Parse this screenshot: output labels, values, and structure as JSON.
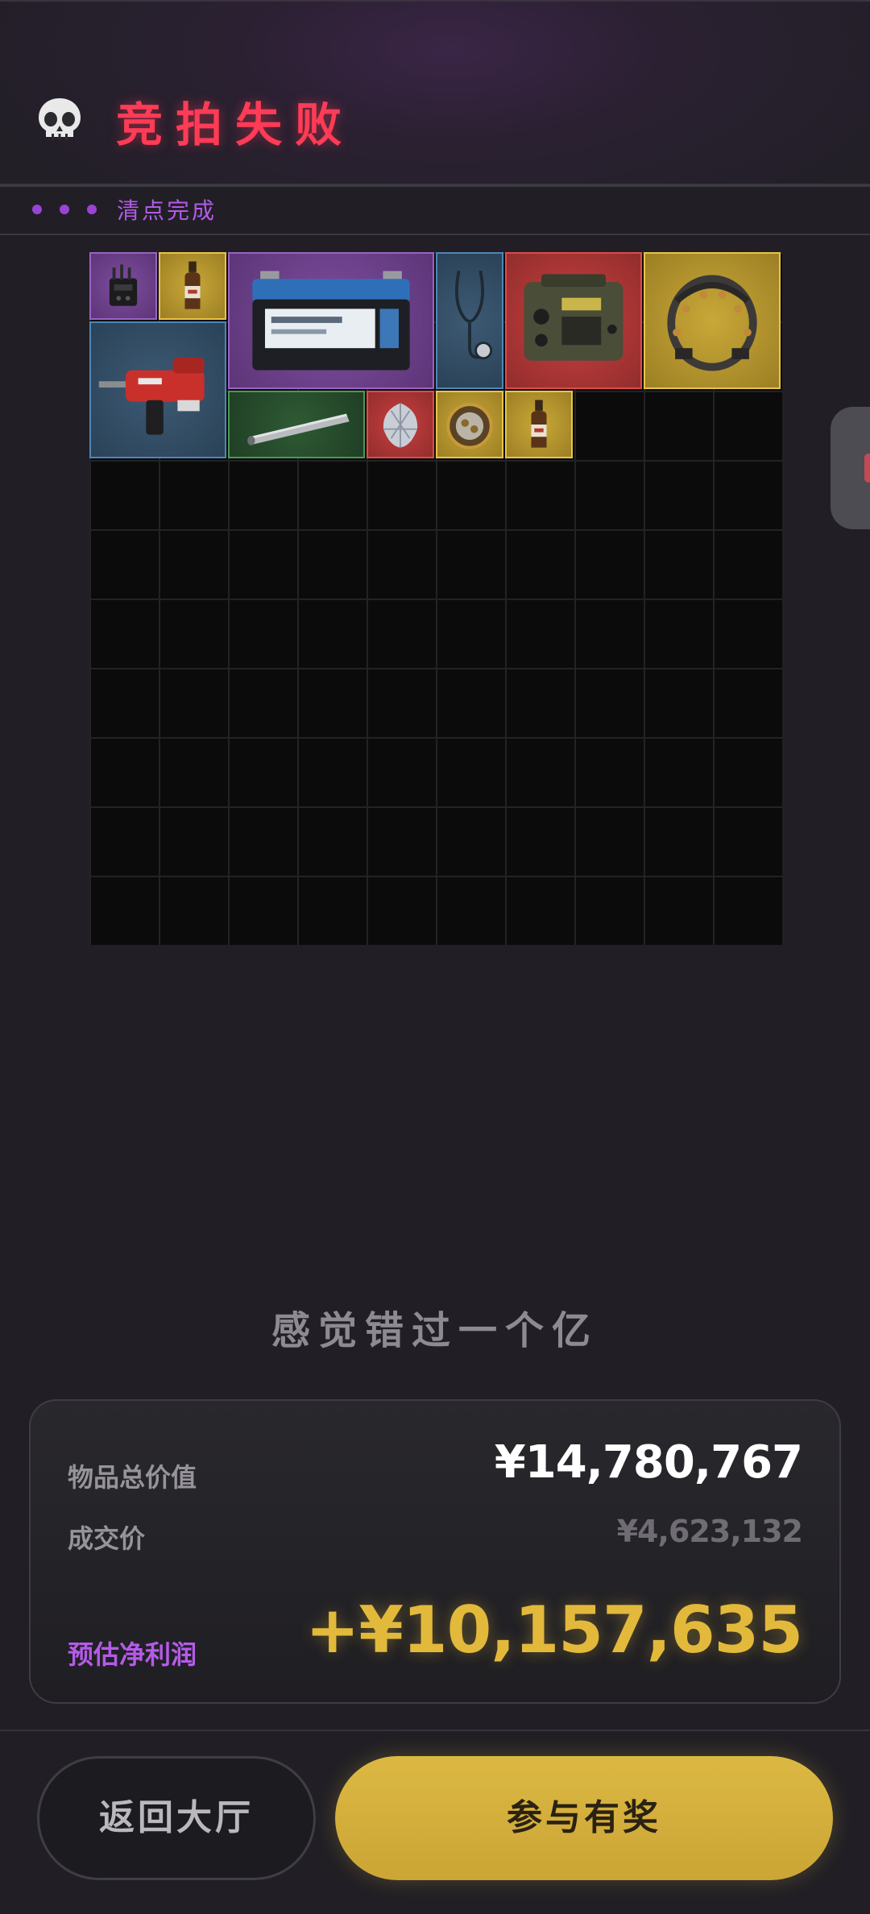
{
  "header": {
    "title": "竞拍失败",
    "skull_icon": "skull-icon"
  },
  "status": {
    "text": "清点完成",
    "dot_color": "#9a44d6"
  },
  "items": [
    {
      "name": "radio-transmitter",
      "rarity": "purple"
    },
    {
      "name": "liquor-bottle",
      "rarity": "gold"
    },
    {
      "name": "car-battery",
      "rarity": "purple"
    },
    {
      "name": "stethoscope",
      "rarity": "blue"
    },
    {
      "name": "military-radio",
      "rarity": "red"
    },
    {
      "name": "brain-helmet",
      "rarity": "gold"
    },
    {
      "name": "rotary-hammer-drill",
      "rarity": "blue"
    },
    {
      "name": "metal-rod",
      "rarity": "green"
    },
    {
      "name": "diamond",
      "rarity": "red"
    },
    {
      "name": "pocket-watch",
      "rarity": "gold"
    },
    {
      "name": "liquor-bottle",
      "rarity": "gold"
    }
  ],
  "tagline": "感觉错过一个亿",
  "summary": {
    "total_label": "物品总价值",
    "total_value": "¥14,780,767",
    "deal_label": "成交价",
    "deal_value": "¥4,623,132",
    "profit_label": "预估净利润",
    "profit_value": "+¥10,157,635"
  },
  "buttons": {
    "back": "返回大厅",
    "join": "参与有奖"
  },
  "colors": {
    "title": "#ff3b56",
    "profit": "#e3b93b",
    "accent_purple": "#b45be8",
    "join_button": "#d4b13d"
  }
}
